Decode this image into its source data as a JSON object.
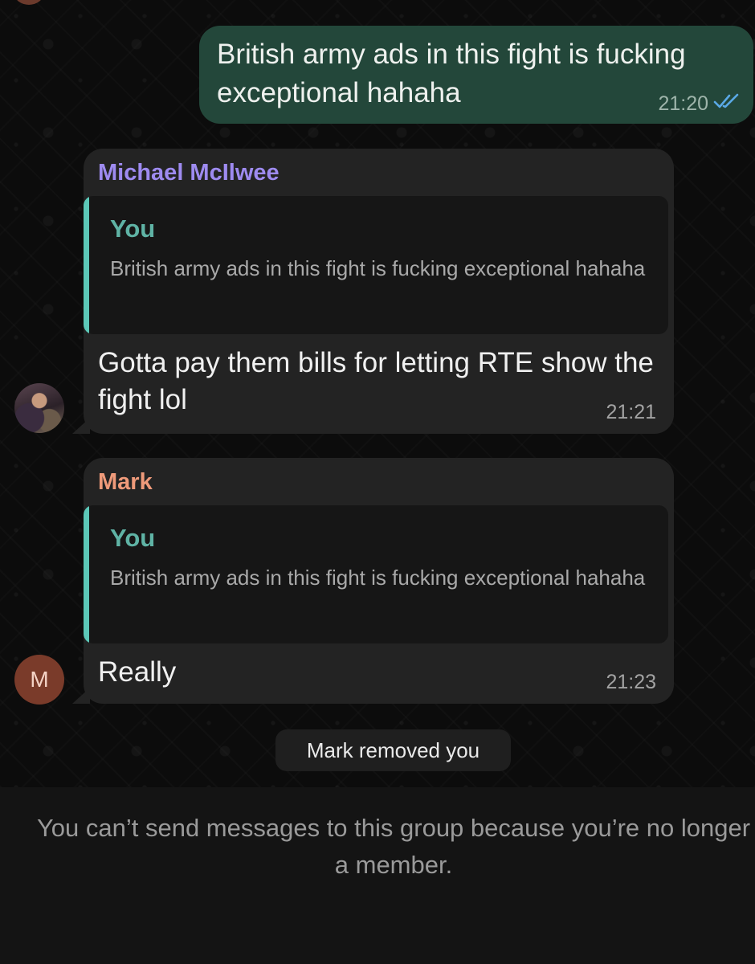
{
  "messages": {
    "outgoing": {
      "text": "British army ads in this fight is fucking exceptional hahaha",
      "time": "21:20"
    },
    "incoming": [
      {
        "sender": "Michael McIlwee",
        "reply_to_name": "You",
        "reply_to_text": "British army ads in this fight is fucking exceptional hahaha",
        "text": "Gotta pay them bills for letting RTE show the fight lol",
        "time": "21:21"
      },
      {
        "sender": "Mark",
        "avatar_letter": "M",
        "reply_to_name": "You",
        "reply_to_text": "British army ads in this fight is fucking exceptional hahaha",
        "text": "Really",
        "time": "21:23"
      }
    ]
  },
  "system_message": "Mark removed you",
  "footer_notice": "You can’t send messages to this group because you’re no longer a member.",
  "colors": {
    "outgoing_bubble": "#23473a",
    "incoming_bubble": "#232323",
    "sender_michael": "#9e8bf0",
    "sender_mark": "#ef9a7a",
    "reply_accent": "#5cc8b8",
    "read_ticks": "#5aa9e6"
  },
  "icons": {
    "read_status": "double-check-icon"
  }
}
